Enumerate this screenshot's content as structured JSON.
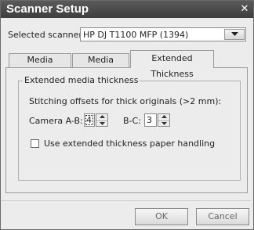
{
  "window": {
    "title": "Scanner Setup"
  },
  "scanner": {
    "label": "Selected scanner:",
    "value": "HP DJ T1100 MFP (1394)"
  },
  "tabs": [
    {
      "label": "Media Handling",
      "active": false
    },
    {
      "label": "Media Offsets",
      "active": false
    },
    {
      "label": "Extended Thickness",
      "active": true
    }
  ],
  "group": {
    "title": "Extended media thickness",
    "offsets_label": "Stitching offsets for thick originals (>2 mm):",
    "camera_ab_label": "Camera A-B:",
    "camera_ab_value": "4",
    "bc_label": "B-C:",
    "bc_value": "3",
    "checkbox_label": "Use extended thickness paper handling",
    "checkbox_checked": false
  },
  "buttons": {
    "ok": "OK",
    "cancel": "Cancel"
  },
  "icons": [
    "close-icon",
    "dropdown-arrow-icon",
    "spin-up-icon",
    "spin-down-icon"
  ]
}
